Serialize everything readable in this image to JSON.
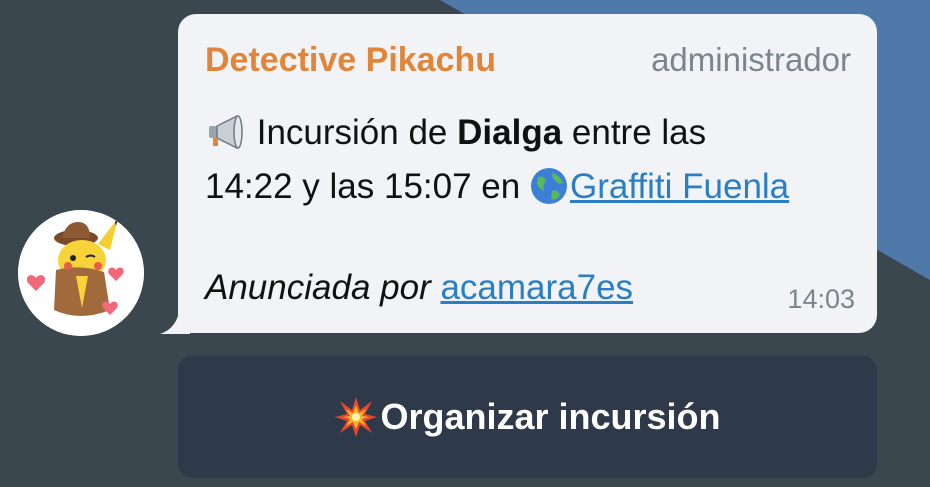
{
  "message": {
    "sender": "Detective Pikachu",
    "role": "administrador",
    "line1_prefix": " Incursión de ",
    "boss": "Dialga",
    "line1_suffix": " entre las",
    "line2": "14:22 y las 15:07 en ",
    "location_link": "Graffiti Fuenla",
    "announced_prefix": "Anunciada por ",
    "announcer_link": "acamara7es",
    "time": "14:03"
  },
  "action_button": {
    "label": "Organizar incursión"
  },
  "icons": {
    "megaphone": "megaphone-icon",
    "globe": "globe-icon",
    "collision": "collision-icon",
    "avatar": "pikachu-avatar"
  },
  "colors": {
    "background": "#3a474f",
    "accent_background": "#4f79a8",
    "bubble": "#f1f3f6",
    "sender": "#e0853a",
    "link": "#2a7fc4",
    "button": "#2e3a4a"
  }
}
